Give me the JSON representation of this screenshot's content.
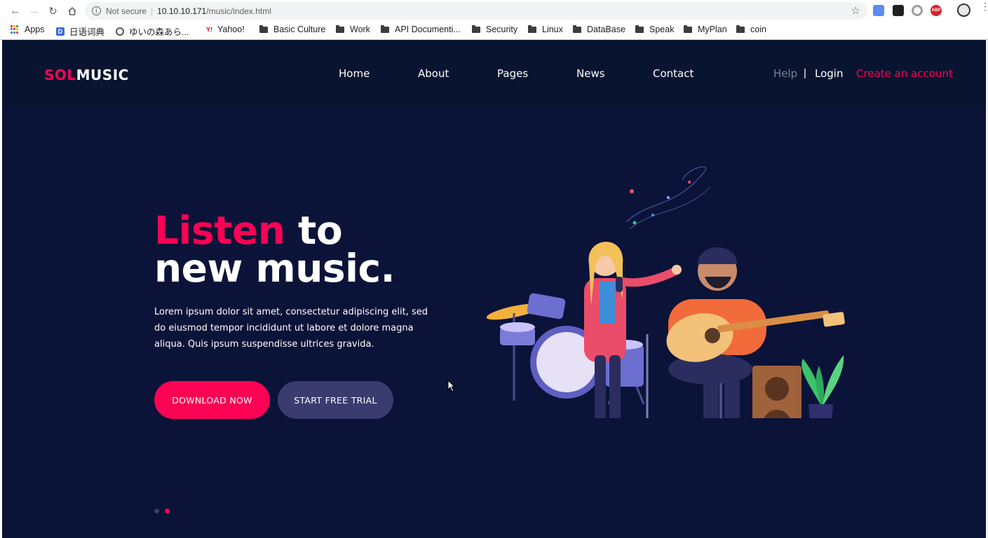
{
  "browser": {
    "security_label": "Not secure",
    "url_host": "10.10.10.171",
    "url_path": "/music/index.html",
    "bookmarks": [
      {
        "label": "Apps",
        "icon": "apps-grid-icon"
      },
      {
        "label": "日语词典",
        "icon": "dictionary-icon"
      },
      {
        "label": "ゆいの森あら...",
        "icon": "globe-icon"
      },
      {
        "label": "Yahoo!",
        "icon": "yahoo-icon"
      },
      {
        "label": "Basic Culture",
        "icon": "folder-icon"
      },
      {
        "label": "Work",
        "icon": "folder-icon"
      },
      {
        "label": "API Documenti...",
        "icon": "folder-icon"
      },
      {
        "label": "Security",
        "icon": "folder-icon"
      },
      {
        "label": "Linux",
        "icon": "folder-icon"
      },
      {
        "label": "DataBase",
        "icon": "folder-icon"
      },
      {
        "label": "Speak",
        "icon": "folder-icon"
      },
      {
        "label": "MyPlan",
        "icon": "folder-icon"
      },
      {
        "label": "coin",
        "icon": "folder-icon"
      }
    ],
    "extension_badge": "ABP"
  },
  "site": {
    "logo_accent": "SOL",
    "logo_rest": "MUSIC",
    "nav": [
      "Home",
      "About",
      "Pages",
      "News",
      "Contact"
    ],
    "help": "Help",
    "divider": "|",
    "login": "Login",
    "create_account": "Create an account"
  },
  "hero": {
    "title_accent": "Listen",
    "title_line1_rest": " to",
    "title_line2": "new music.",
    "text": "Lorem ipsum dolor sit amet, consectetur adipiscing elit, sed do eiusmod tempor incididunt ut labore et dolore magna aliqua. Quis ipsum suspendisse ultrices gravida.",
    "primary_button": "DOWNLOAD NOW",
    "secondary_button": "START FREE TRIAL",
    "slide_count": 2,
    "active_slide": 2
  },
  "colors": {
    "accent": "#fc0254",
    "page_background": "#0b1338",
    "header_background": "#091430",
    "secondary_button": "#3a3b6e"
  }
}
